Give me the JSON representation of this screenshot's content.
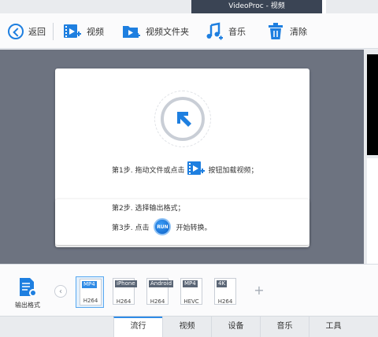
{
  "window": {
    "title": "VideoProc - 视频"
  },
  "toolbar": {
    "back_label": "返回",
    "video_label": "视频",
    "folder_label": "视频文件夹",
    "music_label": "音乐",
    "clear_label": "清除"
  },
  "main": {
    "step1_before": "第1步. 拖动文件或点击",
    "step1_after": "按钮加载视频；",
    "step2": "第2步. 选择输出格式；",
    "step3_before": "第3步. 点击",
    "run_label": "RUN",
    "step3_after": "开始转换。"
  },
  "output": {
    "label": "输出格式"
  },
  "formats": [
    {
      "tag": "MP4",
      "codec": "H264",
      "selected": true
    },
    {
      "tag": "iPhone",
      "codec": "H264"
    },
    {
      "tag": "Android",
      "codec": "H264"
    },
    {
      "tag": "MP4",
      "codec": "HEVC"
    },
    {
      "tag": "4K",
      "codec": "H264"
    }
  ],
  "tabs": [
    "流行",
    "视频",
    "设备",
    "音乐",
    "工具"
  ],
  "colors": {
    "accent": "#2f8be6",
    "title_bg": "#3a4454",
    "stage_bg": "#6d7380"
  }
}
